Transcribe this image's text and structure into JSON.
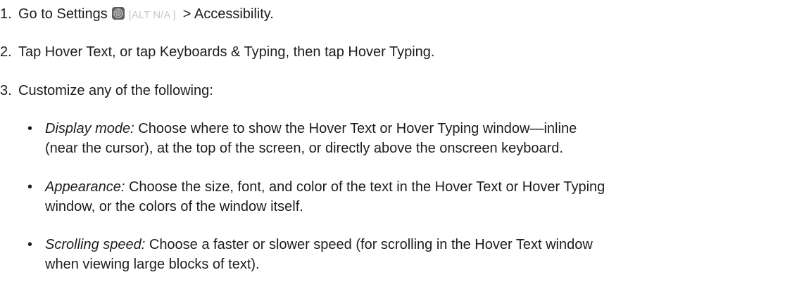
{
  "steps": [
    {
      "number": "1.",
      "text_before": "Go to Settings",
      "icon": "settings-gear-icon",
      "alt_text": "[ALT N/A ]",
      "text_after": "> Accessibility."
    },
    {
      "number": "2.",
      "text": "Tap Hover Text, or tap Keyboards & Typing, then tap Hover Typing."
    },
    {
      "number": "3.",
      "text": "Customize any of the following:"
    }
  ],
  "bullet_char": "•",
  "bullets": [
    {
      "term": "Display mode:",
      "line1": " Choose where to show the Hover Text or Hover Typing window—inline",
      "line2": "(near the cursor), at the top of the screen, or directly above the onscreen keyboard."
    },
    {
      "term": "Appearance:",
      "line1": " Choose the size, font, and color of the text in the Hover Text or Hover Typing",
      "line2": "window, or the colors of the window itself."
    },
    {
      "term": "Scrolling speed:",
      "line1": " Choose a faster or slower speed (for scrolling in the Hover Text window",
      "line2": "when viewing large blocks of text)."
    }
  ]
}
